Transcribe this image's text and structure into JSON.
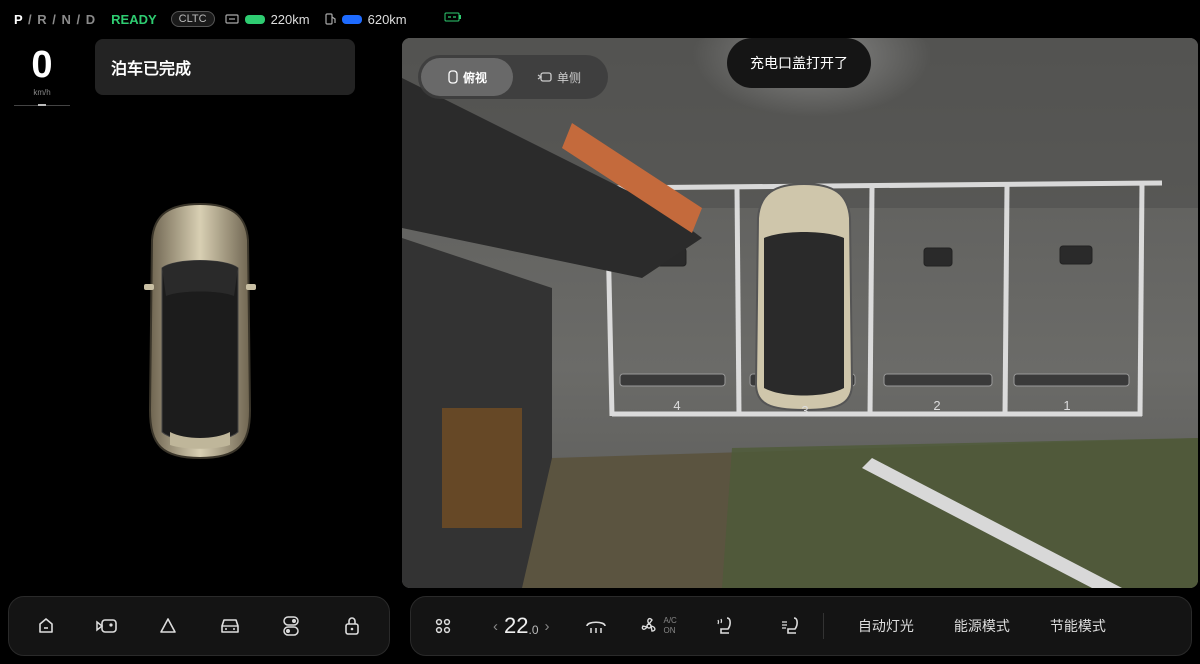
{
  "status": {
    "gears": [
      "P",
      "R",
      "N",
      "D"
    ],
    "active_gear": "P",
    "ready": "READY",
    "cltc": "CLTC",
    "range_electric": "220km",
    "range_fuel": "620km",
    "colors": {
      "ready": "#2ecc71",
      "battery": "#2ecc71",
      "fuel": "#1e6bff"
    }
  },
  "speed": {
    "value": "0",
    "unit": "km/h"
  },
  "notice": {
    "text": "泊车已完成"
  },
  "camera": {
    "view_toggle": {
      "top_view": "俯视",
      "side_view": "单侧",
      "selected": "top_view"
    },
    "alert": "充电口盖打开了",
    "slot_labels": [
      "4",
      "3",
      "2",
      "1"
    ]
  },
  "dock_left": {
    "icons": [
      "home-icon",
      "camera-icon",
      "triangle-warning-icon",
      "car-front-icon",
      "toggle-icon",
      "lock-icon"
    ]
  },
  "dock_right": {
    "temperature": {
      "value": "22",
      "decimal": ".0"
    },
    "ac": {
      "line1": "A/C",
      "line2": "ON"
    },
    "buttons": {
      "auto_lights": "自动灯光",
      "energy_mode": "能源模式",
      "eco_mode": "节能模式"
    }
  }
}
